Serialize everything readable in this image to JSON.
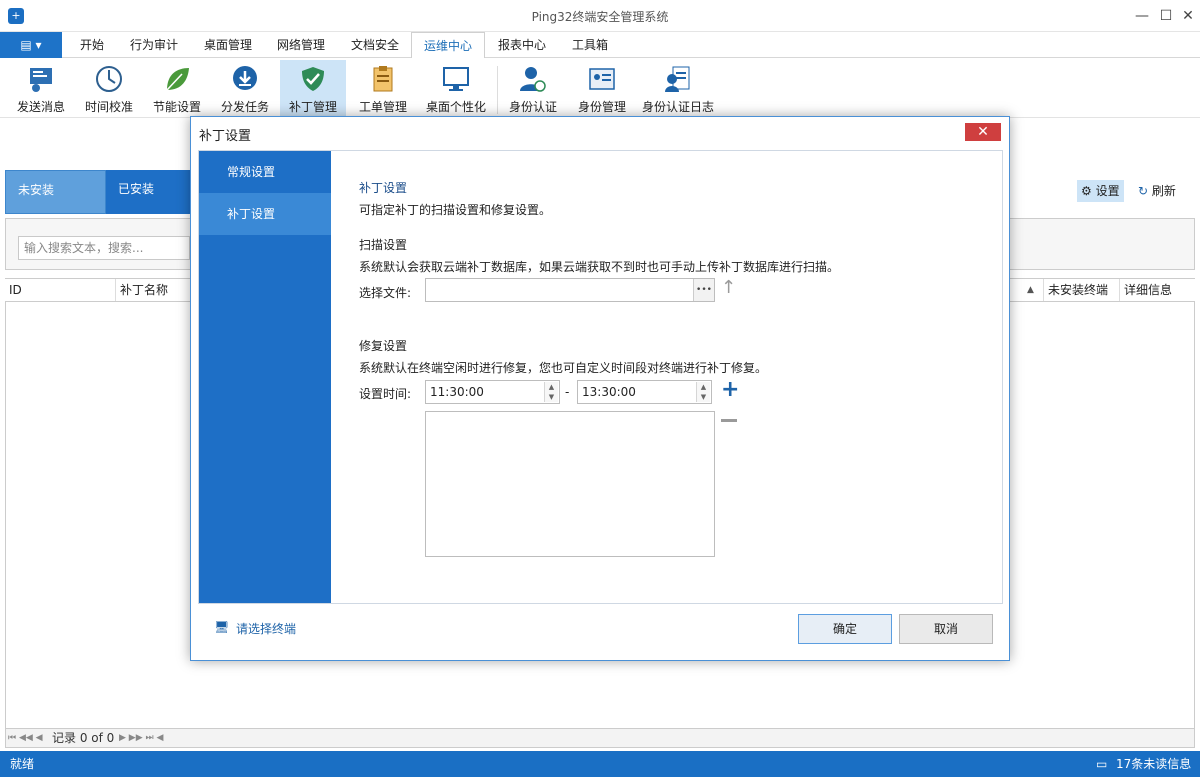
{
  "window": {
    "title": "Ping32终端安全管理系统",
    "min": "—",
    "max": "☐",
    "close": "✕"
  },
  "tabs": [
    "开始",
    "行为审计",
    "桌面管理",
    "网络管理",
    "文档安全",
    "运维中心",
    "报表中心",
    "工具箱"
  ],
  "active_tab": "运维中心",
  "ribbon": [
    {
      "label": "发送消息",
      "icon": "send-message-icon"
    },
    {
      "label": "时间校准",
      "icon": "clock-icon"
    },
    {
      "label": "节能设置",
      "icon": "leaf-icon"
    },
    {
      "label": "分发任务",
      "icon": "download-icon"
    },
    {
      "label": "补丁管理",
      "icon": "shield-icon"
    },
    {
      "label": "工单管理",
      "icon": "clipboard-icon"
    },
    {
      "label": "桌面个性化",
      "icon": "monitor-icon"
    },
    {
      "label": "身份认证",
      "icon": "fingerprint-user-icon"
    },
    {
      "label": "身份管理",
      "icon": "id-card-icon"
    },
    {
      "label": "身份认证日志",
      "icon": "user-log-icon"
    }
  ],
  "panel": {
    "tab_uninstalled": "未安装",
    "tab_installed": "已安装",
    "settings": "设置",
    "refresh": "刷新",
    "search_placeholder": "输入搜索文本，搜索...",
    "columns": {
      "id": "ID",
      "name": "补丁名称",
      "uninstalled": "未安装终端",
      "detail": "详细信息"
    },
    "pager_text": "记录 0 of 0"
  },
  "status": {
    "left": "就绪",
    "right": "17条未读信息"
  },
  "dialog": {
    "title": "补丁设置",
    "nav": [
      "常规设置",
      "补丁设置"
    ],
    "section1_title": "补丁设置",
    "section1_desc": "可指定补丁的扫描设置和修复设置。",
    "scan_title": "扫描设置",
    "scan_desc": "系统默认会获取云端补丁数据库，如果云端获取不到时也可手动上传补丁数据库进行扫描。",
    "file_label": "选择文件:",
    "file_value": "",
    "browse": "•••",
    "repair_title": "修复设置",
    "repair_desc": "系统默认在终端空闲时进行修复，您也可自定义时间段对终端进行补丁修复。",
    "time_label": "设置时间:",
    "time_start": "11:30:00",
    "time_end": "13:30:00",
    "dash": "-",
    "select_terminal": "请选择终端",
    "ok": "确定",
    "cancel": "取消"
  }
}
